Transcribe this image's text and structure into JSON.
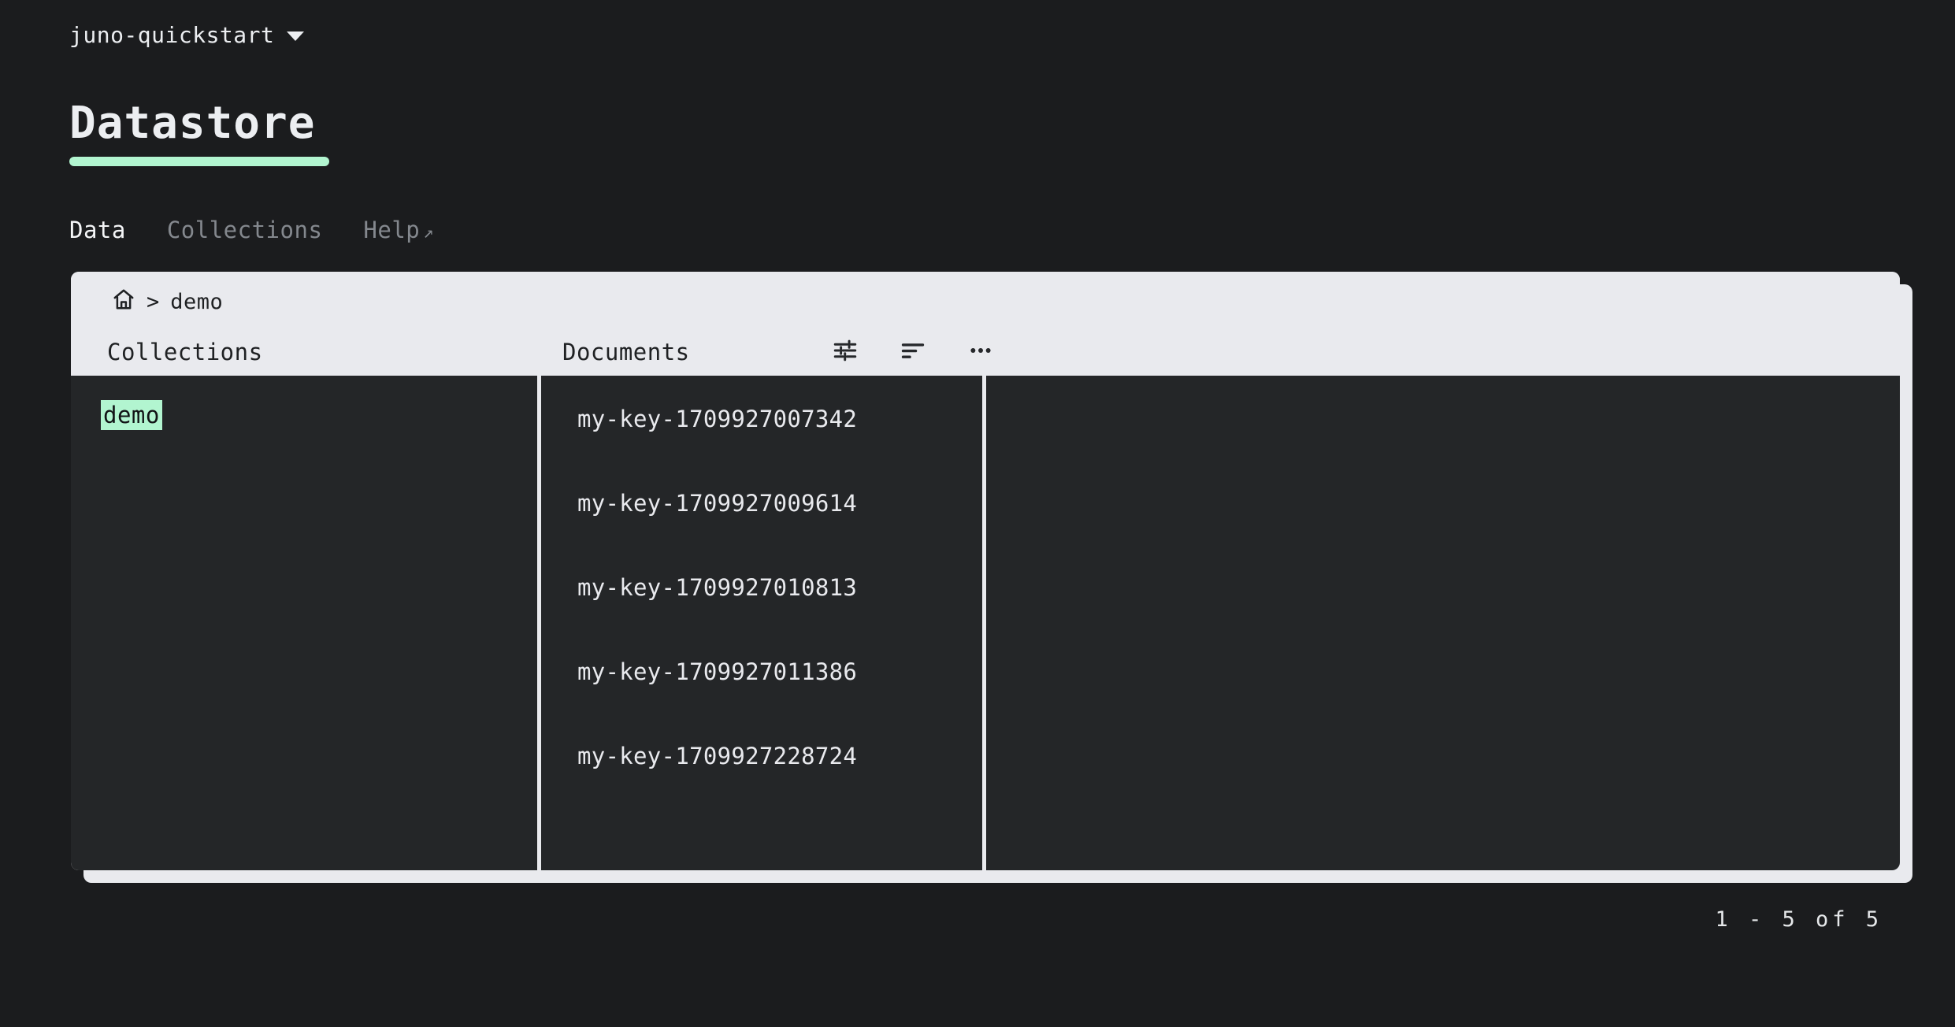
{
  "project": {
    "name": "juno-quickstart",
    "caret_icon": "chevron-down-icon"
  },
  "header": {
    "title": "Datastore",
    "accent_color": "#b2f5d0"
  },
  "tabs": [
    {
      "label": "Data",
      "active": true
    },
    {
      "label": "Collections",
      "active": false
    },
    {
      "label": "Help",
      "active": false,
      "external": "↗"
    }
  ],
  "breadcrumb": {
    "home_icon": "home-icon",
    "separator": ">",
    "items": [
      "demo"
    ]
  },
  "columns": {
    "collections_header": "Collections",
    "documents_header": "Documents"
  },
  "toolbar": {
    "filter_icon": "tune-icon",
    "sort_icon": "sort-icon",
    "more_icon": "more-horizontal-icon"
  },
  "collections": [
    {
      "name": "demo",
      "selected": true
    }
  ],
  "documents": [
    {
      "key": "my-key-1709927007342"
    },
    {
      "key": "my-key-1709927009614"
    },
    {
      "key": "my-key-1709927010813"
    },
    {
      "key": "my-key-1709927011386"
    },
    {
      "key": "my-key-1709927228724"
    }
  ],
  "detail": {
    "content": ""
  },
  "pagination": {
    "range": "1 - 5 of 5"
  },
  "colors": {
    "background": "#1b1c1e",
    "panel_light": "#e9eaee",
    "panel_dark": "#242628",
    "accent_green": "#b2f5d0",
    "text_primary": "#eceef1",
    "text_muted": "#84888e"
  }
}
